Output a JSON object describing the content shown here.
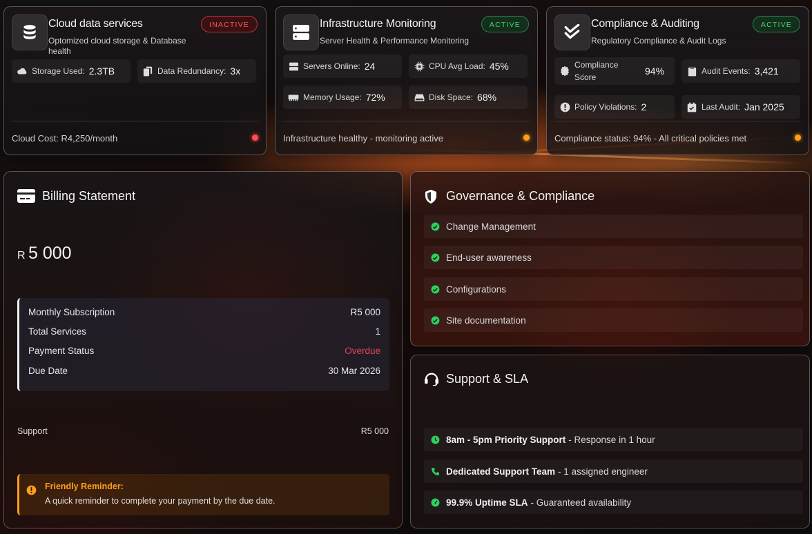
{
  "services": [
    {
      "title": "Cloud data services",
      "subtitle": "Optomized cloud storage & Database health",
      "status": "INACTIVE",
      "metrics": [
        {
          "label": "Storage Used",
          "value": "2.3TB",
          "icon": "cloud-icon"
        },
        {
          "label": "Data Redundancy",
          "value": "3x",
          "icon": "copy-icon"
        }
      ],
      "footer": "Cloud Cost: R4,250/month",
      "indicator_color": "#ff4d4d"
    },
    {
      "title": "Infrastructure Monitoring",
      "subtitle": "Server Health & Performance Monitoring",
      "status": "ACTIVE",
      "metrics": [
        {
          "label": "Servers Online",
          "value": "24",
          "icon": "server-icon"
        },
        {
          "label": "CPU Avg Load",
          "value": "45%",
          "icon": "cpu-icon"
        },
        {
          "label": "Memory Usage",
          "value": "72%",
          "icon": "memory-icon"
        },
        {
          "label": "Disk Space",
          "value": "68%",
          "icon": "disk-icon"
        }
      ],
      "footer": "Infrastructure healthy - monitoring active",
      "indicator_color": "#ff9f1a"
    },
    {
      "title": "Compliance & Auditing",
      "subtitle": "Regulatory Compliance & Audit Logs",
      "status": "ACTIVE",
      "metrics": [
        {
          "label": "Compliance Score",
          "value": "94%",
          "icon": "certificate-icon"
        },
        {
          "label": "Audit Events",
          "value": "3,421",
          "icon": "clipboard-icon"
        },
        {
          "label": "Policy Violations",
          "value": "2",
          "icon": "alert-icon"
        },
        {
          "label": "Last Audit",
          "value": "Jan 2025",
          "icon": "calendar-check-icon"
        }
      ],
      "footer": "Compliance status: 94% - All critical policies met",
      "indicator_color": "#ff9f1a"
    }
  ],
  "billing": {
    "title": "Billing Statement",
    "currency": "R",
    "amount": "5 000",
    "details": [
      {
        "label": "Monthly Subscription",
        "value": "R5 000"
      },
      {
        "label": "Total Services",
        "value": "1"
      },
      {
        "label": "Payment Status",
        "value": "Overdue"
      },
      {
        "label": "Due Date",
        "value": "30 Mar 2026"
      }
    ],
    "support_label": "Support",
    "support_value": "R5 000",
    "reminder_title": "Friendly Reminder:",
    "reminder_text": "A quick reminder to complete your payment by the due date."
  },
  "governance": {
    "title": "Governance & Compliance",
    "items": [
      "Change Management",
      "End-user awareness",
      "Configurations",
      "Site documentation"
    ]
  },
  "support": {
    "title": "Support & SLA",
    "items": [
      {
        "bold": "8am - 5pm Priority Support",
        "text": "- Response in 1 hour",
        "icon": "clock-icon"
      },
      {
        "bold": "Dedicated Support Team",
        "text": "- 1 assigned engineer",
        "icon": "phone-icon"
      },
      {
        "bold": "99.9% Uptime SLA",
        "text": "- Guaranteed availability",
        "icon": "gauge-icon"
      }
    ]
  },
  "colors": {
    "green": "#2fcf5f",
    "orange": "#ff9f1a",
    "red": "#ff4d4d",
    "overdue": "#e0475a"
  }
}
